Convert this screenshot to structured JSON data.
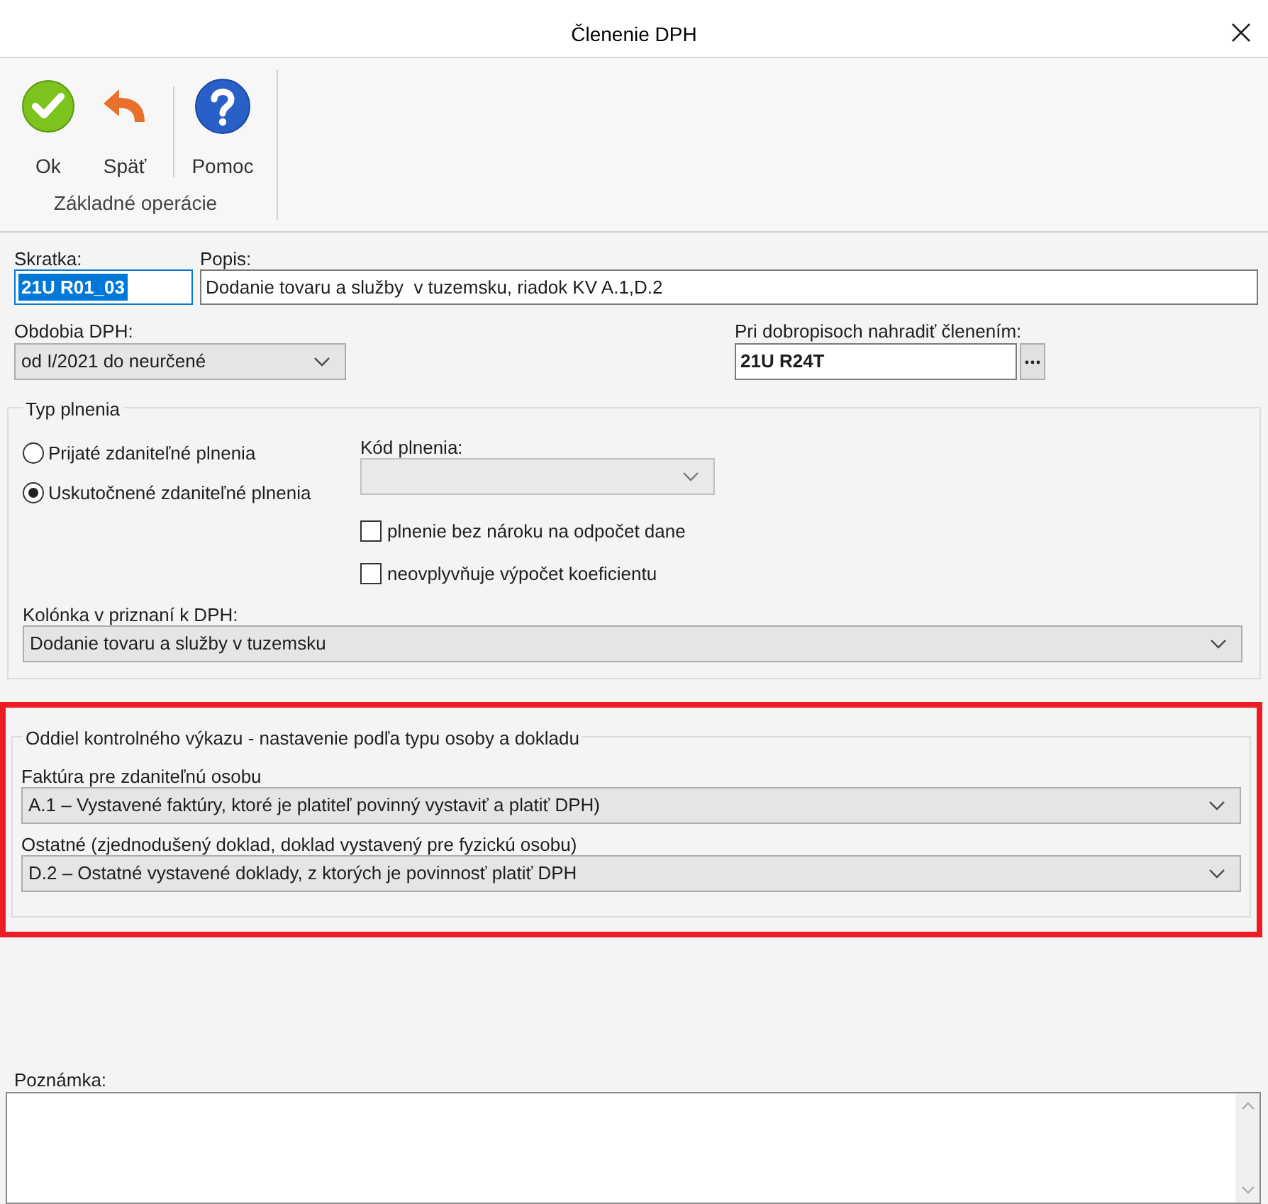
{
  "window": {
    "title": "Členenie DPH"
  },
  "toolbar": {
    "button_groups": [
      [
        {
          "label": "Ok",
          "kind": "ok"
        },
        {
          "label": "Späť",
          "kind": "back"
        }
      ],
      [
        {
          "label": "Pomoc",
          "kind": "help"
        }
      ]
    ],
    "group_label": "Základné operácie"
  },
  "skratka": {
    "label": "Skratka:",
    "value": "21U R01_03",
    "selected": true
  },
  "popis": {
    "label": "Popis:",
    "value": "Dodanie tovaru a služby  v tuzemsku, riadok KV A.1,D.2"
  },
  "obdobia": {
    "label": "Obdobia DPH:",
    "value": "od I/2021 do neurčené"
  },
  "dobropis": {
    "label": "Pri dobropisoch nahradiť členením:",
    "value": "21U R24T"
  },
  "typ_plnenia": {
    "legend": "Typ plnenia",
    "options": [
      {
        "label": "Prijaté zdaniteľné plnenia",
        "selected": false
      },
      {
        "label": "Uskutočnené zdaniteľné plnenia",
        "selected": true
      }
    ],
    "kod_plnenia": {
      "label": "Kód plnenia:",
      "disabled": true
    },
    "checkboxes": [
      {
        "label": "plnenie bez nároku na odpočet dane",
        "checked": false
      },
      {
        "label": "neovplyvňuje výpočet koeficientu",
        "checked": false
      }
    ],
    "kolonka": {
      "label": "Kolónka v priznaní k DPH:",
      "value": "Dodanie tovaru a služby v tuzemsku"
    }
  },
  "kontrolny_vykaz": {
    "legend": "Oddiel kontrolného výkazu - nastavenie podľa typu osoby a dokladu",
    "highlighted": true,
    "fields": [
      {
        "label": "Faktúra pre zdaniteľnú osobu",
        "value": "A.1 – Vystavené faktúry, ktoré je platiteľ povinný vystaviť a platiť DPH)"
      },
      {
        "label": "Ostatné (zjednodušený doklad, doklad vystavený pre fyzickú osobu)",
        "value": "D.2 – Ostatné vystavené doklady, z ktorých je povinnosť platiť DPH"
      }
    ]
  },
  "poznamka": {
    "label": "Poznámka:"
  }
}
